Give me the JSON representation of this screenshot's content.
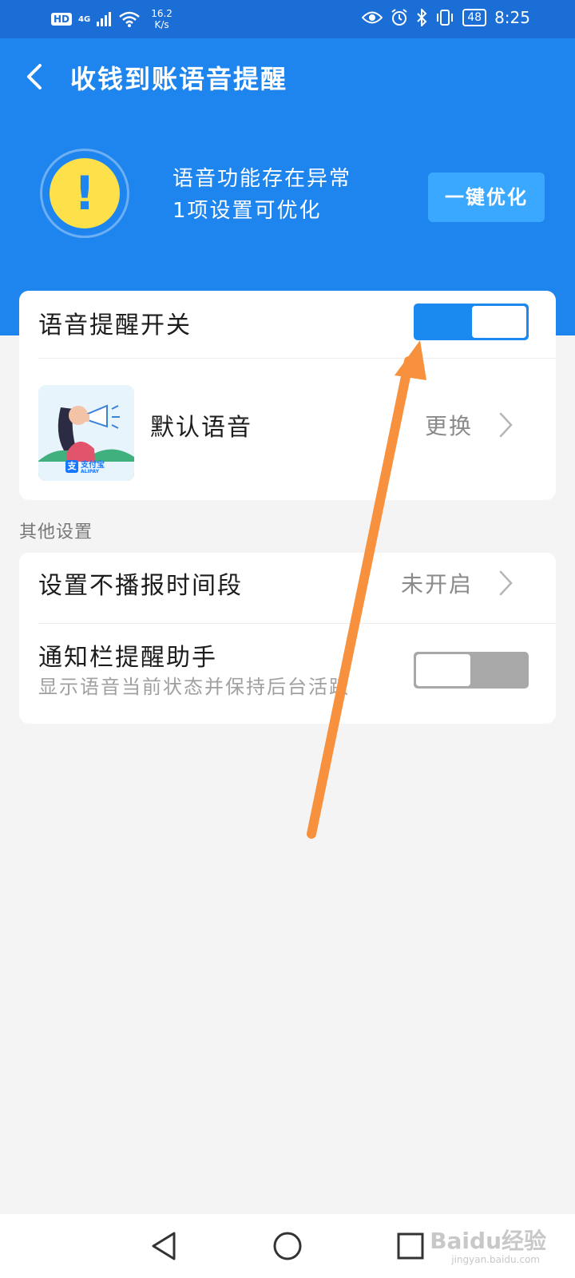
{
  "status_bar": {
    "hd": "HD",
    "network": "4G",
    "speed_value": "16.2",
    "speed_unit": "K/s",
    "battery": "48",
    "time": "8:25"
  },
  "header": {
    "title": "收钱到账语音提醒"
  },
  "warning": {
    "line1": "语音功能存在异常",
    "line2": "1项设置可优化",
    "button": "一键优化"
  },
  "voice_switch": {
    "label": "语音提醒开关",
    "on": true
  },
  "default_voice": {
    "label": "默认语音",
    "action": "更换",
    "thumb_brand": "支付宝",
    "thumb_brand_sub": "ALIPAY"
  },
  "other_settings": {
    "section_label": "其他设置",
    "no_broadcast": {
      "label": "设置不播报时间段",
      "value": "未开启"
    },
    "notify_helper": {
      "label": "通知栏提醒助手",
      "sub": "显示语音当前状态并保持后台活跃",
      "on": false
    }
  },
  "watermark": {
    "main": "Baidu经验",
    "sub": "jingyan.baidu.com"
  },
  "colors": {
    "primary": "#1f85ee",
    "status_bar": "#1b6ed6",
    "warning_yellow": "#fde04a",
    "button": "#3aa8ff",
    "arrow": "#f7913d"
  }
}
